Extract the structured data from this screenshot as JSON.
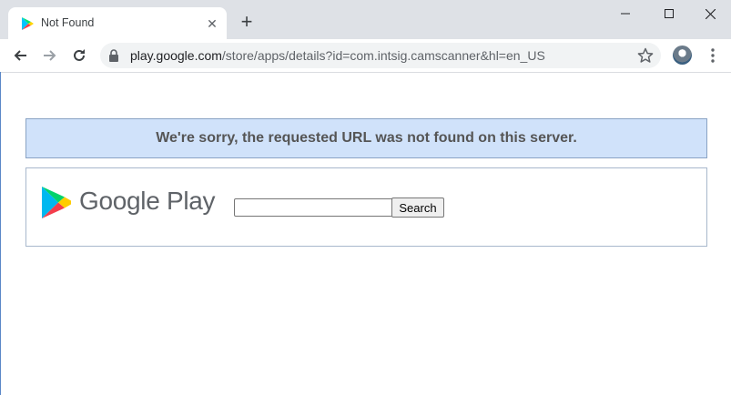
{
  "browser": {
    "tab": {
      "title": "Not Found",
      "favicon": "google-play-icon",
      "close_icon": "close-icon"
    },
    "new_tab_icon": "plus-icon",
    "window_controls": [
      "minimize-icon",
      "maximize-icon",
      "close-icon"
    ],
    "nav": [
      "back-arrow-icon",
      "forward-arrow-icon",
      "reload-icon"
    ],
    "address_bar": {
      "domain": "play.google.com",
      "path": "/store/apps/details?id=com.intsig.camscanner&hl=en_US"
    }
  },
  "page": {
    "error_message": "We're sorry, the requested URL was not found on this server.",
    "logo_text": "Google Play",
    "search": {
      "value": "",
      "button_label": "Search"
    }
  },
  "colors": {
    "banner_bg": "#d0e2fa",
    "banner_border": "#8aa3c4",
    "tabstrip_bg": "#dee1e6"
  }
}
